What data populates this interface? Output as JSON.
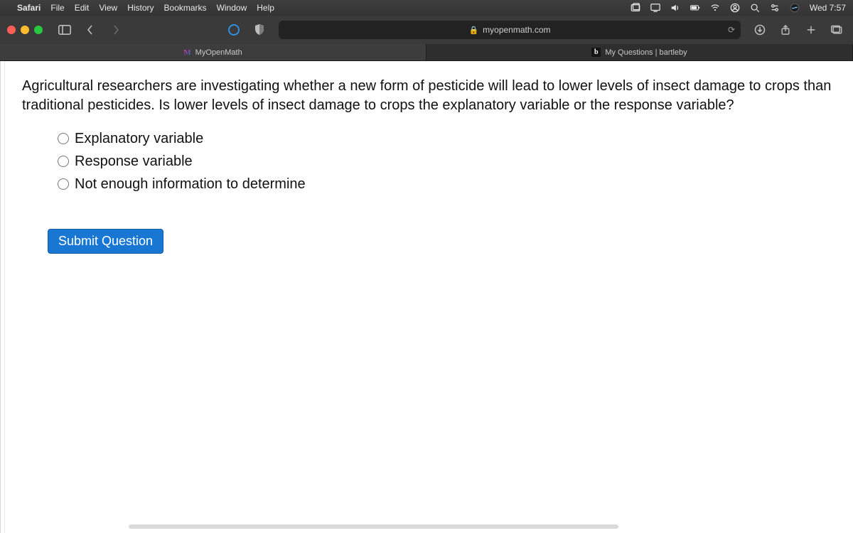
{
  "menubar": {
    "app": "Safari",
    "items": [
      "File",
      "Edit",
      "View",
      "History",
      "Bookmarks",
      "Window",
      "Help"
    ],
    "clock": "Wed 7:57"
  },
  "toolbar": {
    "url_host": "myopenmath.com"
  },
  "tabs": {
    "left": "MyOpenMath",
    "right": "My Questions | bartleby"
  },
  "question": {
    "prompt": "Agricultural researchers are investigating whether a new form of pesticide will lead to lower levels of insect damage to crops than traditional pesticides. Is lower levels of insect damage to crops the explanatory variable or the response variable?",
    "options": [
      "Explanatory variable",
      "Response variable",
      "Not enough information to determine"
    ],
    "submit_label": "Submit Question"
  }
}
